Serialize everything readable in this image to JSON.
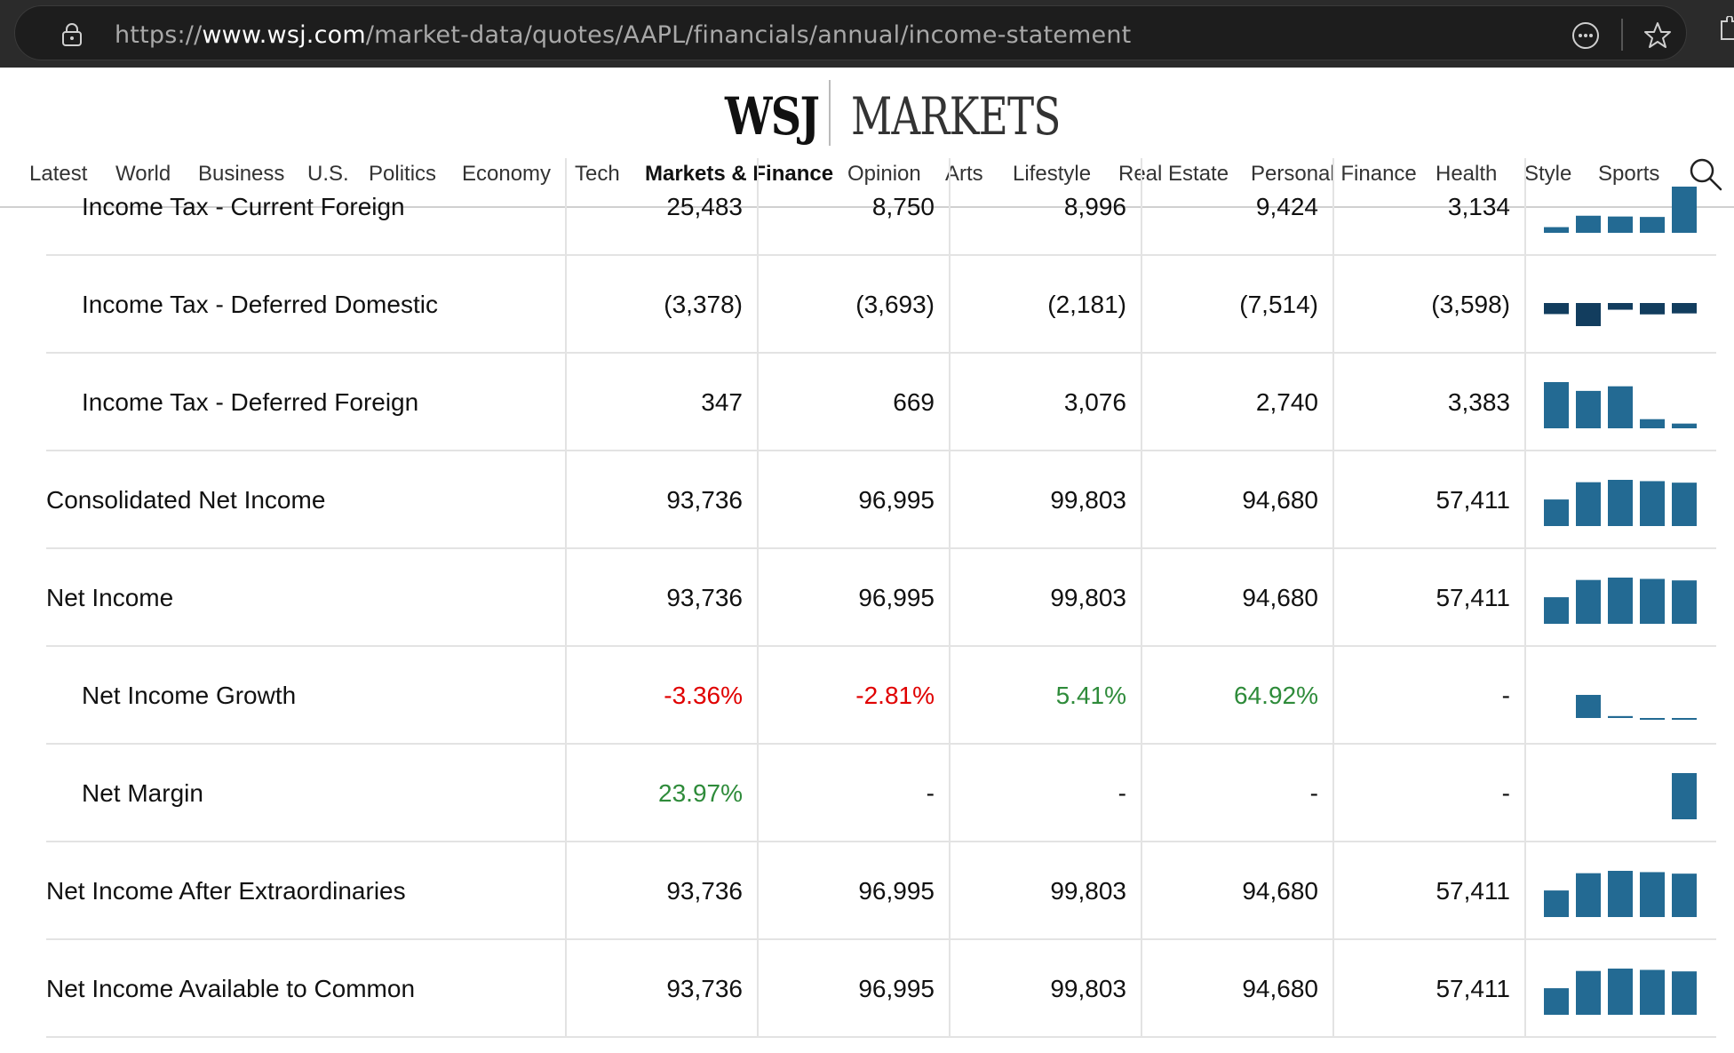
{
  "browser": {
    "url_scheme": "https://",
    "url_host": "www.wsj.com",
    "url_path": "/market-data/quotes/AAPL/financials/annual/income-statement"
  },
  "header": {
    "logo_left": "WSJ",
    "logo_right": "MARKETS",
    "nav": [
      "Latest",
      "World",
      "Business",
      "U.S.",
      "Politics",
      "Economy",
      "Tech",
      "Markets & Finance",
      "Opinion",
      "Arts",
      "Lifestyle",
      "Real Estate",
      "Personal Finance",
      "Health",
      "Style",
      "Sports"
    ],
    "active_nav": "Markets & Finance"
  },
  "colors": {
    "bar": "#236a93",
    "bar_negative": "#123d5e",
    "negative_text": "#e00000",
    "positive_text": "#2e8b3a"
  },
  "rows": [
    {
      "label": "Income Tax - Current Foreign",
      "indent": true,
      "values": [
        "25,483",
        "8,750",
        "8,996",
        "9,424",
        "3,134"
      ],
      "tones": [
        "",
        "",
        "",
        "",
        ""
      ],
      "trend": [
        3134,
        9424,
        8996,
        8750,
        25483
      ],
      "trend_kind": "pos"
    },
    {
      "label": "Income Tax - Deferred Domestic",
      "indent": true,
      "values": [
        "(3,378)",
        "(3,693)",
        "(2,181)",
        "(7,514)",
        "(3,598)"
      ],
      "tones": [
        "",
        "",
        "",
        "",
        ""
      ],
      "trend": [
        -3598,
        -7514,
        -2181,
        -3693,
        -3378
      ],
      "trend_kind": "neg"
    },
    {
      "label": "Income Tax - Deferred Foreign",
      "indent": true,
      "values": [
        "347",
        "669",
        "3,076",
        "2,740",
        "3,383"
      ],
      "tones": [
        "",
        "",
        "",
        "",
        ""
      ],
      "trend": [
        3383,
        2740,
        3076,
        669,
        347
      ],
      "trend_kind": "pos"
    },
    {
      "label": "Consolidated Net Income",
      "indent": false,
      "values": [
        "93,736",
        "96,995",
        "99,803",
        "94,680",
        "57,411"
      ],
      "tones": [
        "",
        "",
        "",
        "",
        ""
      ],
      "trend": [
        57411,
        94680,
        99803,
        96995,
        93736
      ],
      "trend_kind": "pos"
    },
    {
      "label": "Net Income",
      "indent": false,
      "values": [
        "93,736",
        "96,995",
        "99,803",
        "94,680",
        "57,411"
      ],
      "tones": [
        "",
        "",
        "",
        "",
        ""
      ],
      "trend": [
        57411,
        94680,
        99803,
        96995,
        93736
      ],
      "trend_kind": "pos"
    },
    {
      "label": "Net Income Growth",
      "indent": true,
      "values": [
        "-3.36%",
        "-2.81%",
        "5.41%",
        "64.92%",
        "-"
      ],
      "tones": [
        "neg",
        "neg",
        "pos",
        "pos",
        ""
      ],
      "trend": [
        0,
        64.92,
        5.41,
        -2.81,
        -3.36
      ],
      "trend_kind": "growth"
    },
    {
      "label": "Net Margin",
      "indent": true,
      "values": [
        "23.97%",
        "-",
        "-",
        "-",
        "-"
      ],
      "tones": [
        "pos",
        "",
        "",
        "",
        ""
      ],
      "trend": [
        0,
        0,
        0,
        0,
        23.97
      ],
      "trend_kind": "pos"
    },
    {
      "label": "Net Income After Extraordinaries",
      "indent": false,
      "values": [
        "93,736",
        "96,995",
        "99,803",
        "94,680",
        "57,411"
      ],
      "tones": [
        "",
        "",
        "",
        "",
        ""
      ],
      "trend": [
        57411,
        94680,
        99803,
        96995,
        93736
      ],
      "trend_kind": "pos"
    },
    {
      "label": "Net Income Available to Common",
      "indent": false,
      "values": [
        "93,736",
        "96,995",
        "99,803",
        "94,680",
        "57,411"
      ],
      "tones": [
        "",
        "",
        "",
        "",
        ""
      ],
      "trend": [
        57411,
        94680,
        99803,
        96995,
        93736
      ],
      "trend_kind": "pos"
    }
  ]
}
